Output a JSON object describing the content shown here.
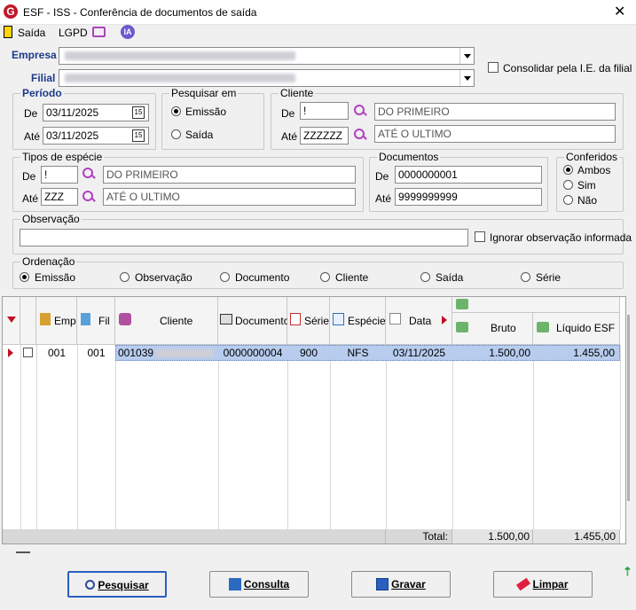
{
  "window": {
    "title": "ESF - ISS - Conferência de documentos de saída"
  },
  "toolbar": {
    "saida": "Saída",
    "lgpd": "LGPD",
    "ia": "IA"
  },
  "empresa": {
    "label": "Empresa"
  },
  "filial": {
    "label": "Filial"
  },
  "consolidar": {
    "label": "Consolidar pela I.E. da filial",
    "checked": false
  },
  "periodo": {
    "title": "Período",
    "de_label": "De",
    "ate_label": "Até",
    "de": "03/11/2025",
    "ate": "03/11/2025"
  },
  "pesquisar_em": {
    "title": "Pesquisar em",
    "options": [
      "Emissão",
      "Saída"
    ],
    "selected": "Emissão"
  },
  "cliente": {
    "title": "Cliente",
    "de_label": "De",
    "ate_label": "Até",
    "de": "!",
    "ate": "ZZZZZZ",
    "de_desc": "DO PRIMEIRO",
    "ate_desc": "ATÉ O ULTIMO"
  },
  "tipos": {
    "title": "Tipos de espécie",
    "de_label": "De",
    "ate_label": "Até",
    "de": "!",
    "ate": "ZZZ",
    "de_desc": "DO PRIMEIRO",
    "ate_desc": "ATÉ O ULTIMO"
  },
  "documentos": {
    "title": "Documentos",
    "de_label": "De",
    "ate_label": "Até",
    "de": "0000000001",
    "ate": "9999999999"
  },
  "conferidos": {
    "title": "Conferidos",
    "options": [
      "Ambos",
      "Sim",
      "Não"
    ],
    "selected": "Ambos"
  },
  "observacao": {
    "title": "Observação",
    "value": "",
    "ignorar_label": "Ignorar observação informada"
  },
  "ordenacao": {
    "title": "Ordenação",
    "options": [
      "Emissão",
      "Observação",
      "Documento",
      "Cliente",
      "Saída",
      "Série"
    ],
    "selected": "Emissão"
  },
  "grid": {
    "columns": {
      "emp": "Emp",
      "fil": "Fil",
      "cliente": "Cliente",
      "documento": "Documento",
      "serie": "Série",
      "especie": "Espécie",
      "data": "Data",
      "bruto": "Bruto",
      "liquido": "Líquido ESF"
    },
    "rows": [
      {
        "emp": "001",
        "fil": "001",
        "cliente": "001039",
        "documento": "0000000004",
        "serie": "900",
        "especie": "NFS",
        "data": "03/11/2025",
        "bruto": "1.500,00",
        "liquido": "1.455,00"
      }
    ],
    "footer": {
      "total_label": "Total:",
      "bruto": "1.500,00",
      "liquido": "1.455,00"
    }
  },
  "buttons": {
    "pesquisar": "Pesquisar",
    "consulta": "Consulta",
    "gravar": "Gravar",
    "limpar": "Limpar"
  }
}
